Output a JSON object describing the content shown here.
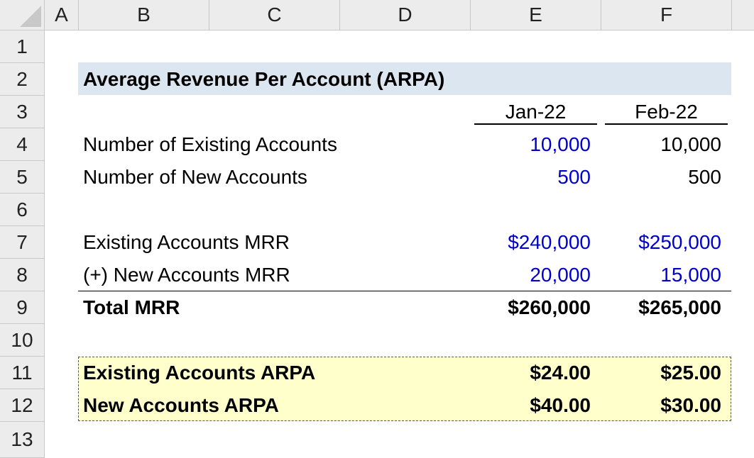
{
  "columns": [
    "A",
    "B",
    "C",
    "D",
    "E",
    "F"
  ],
  "rows": [
    "1",
    "2",
    "3",
    "4",
    "5",
    "6",
    "7",
    "8",
    "9",
    "10",
    "11",
    "12",
    "13"
  ],
  "title": "Average Revenue Per Account (ARPA)",
  "periods": [
    "Jan-22",
    "Feb-22"
  ],
  "existing_accounts": {
    "label": "Number of Existing Accounts",
    "jan": "10,000",
    "feb": "10,000"
  },
  "new_accounts": {
    "label": "Number of New Accounts",
    "jan": "500",
    "feb": "500"
  },
  "existing_mrr": {
    "label": "Existing Accounts MRR",
    "jan": "$240,000",
    "feb": "$250,000"
  },
  "new_mrr": {
    "label": "(+) New Accounts MRR",
    "jan": "20,000",
    "feb": "15,000"
  },
  "total_mrr": {
    "label": "Total MRR",
    "jan": "$260,000",
    "feb": "$265,000"
  },
  "existing_arpa": {
    "label": "Existing Accounts ARPA",
    "jan": "$24.00",
    "feb": "$25.00"
  },
  "new_arpa": {
    "label": "New Accounts ARPA",
    "jan": "$40.00",
    "feb": "$30.00"
  },
  "colors": {
    "input_blue": "#0000cc",
    "title_fill": "#dce6f1",
    "highlight_fill": "#ffffcc"
  }
}
